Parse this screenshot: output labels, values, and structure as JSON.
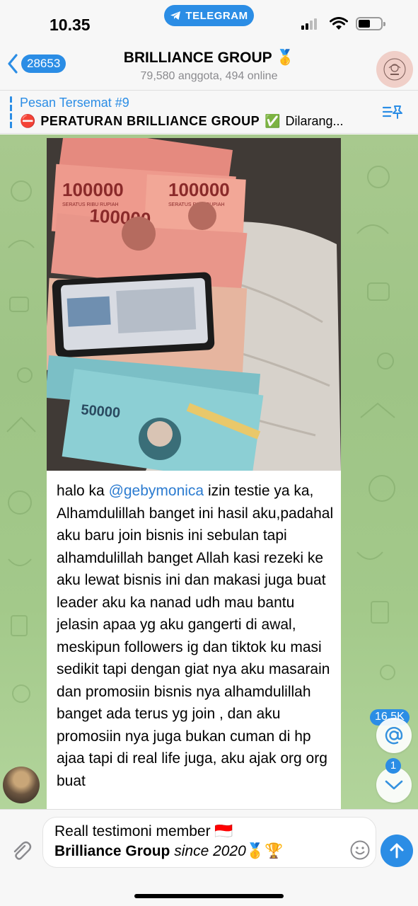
{
  "status_bar": {
    "time": "10.35",
    "app_pill": "TELEGRAM"
  },
  "header": {
    "back_count": "28653",
    "title": "BRILLIANCE GROUP",
    "title_emoji": "🥇",
    "subtitle": "79,580 anggota, 494 online"
  },
  "pinned": {
    "title": "Pesan Tersemat #9",
    "prefix_emoji": "⛔",
    "text_bold": "PERATURAN BRILLIANCE GROUP",
    "check_emoji": "✅",
    "text_rest": "Dilarang..."
  },
  "message": {
    "photo": {
      "banknote_100k": "100000",
      "banknote_100k_small": "SERATUS RIBU RUPIAH",
      "banknote_50k": "50000"
    },
    "greeting": "halo ka",
    "mention": "@gebymonica",
    "body": "izin testie ya ka, Alhamdulillah banget ini hasil aku,padahal aku baru join bisnis ini sebulan tapi alhamdulillah banget Allah kasi rezeki ke aku lewat bisnis ini dan makasi juga buat leader aku ka nanad udh mau bantu jelasin apaa yg aku gangerti di awal, meskipun followers ig dan tiktok ku masi sedikit tapi dengan giat nya aku masarain dan promosiin bisnis nya alhamdulillah banget ada terus yg join , dan aku promosiin nya juga bukan cuman di hp ajaa tapi di real life juga, aku ajak org org buat"
  },
  "floating": {
    "mention_count": "16.5K",
    "scroll_badge": "1"
  },
  "input": {
    "line1": "Reall testimoni member",
    "line1_emoji": "🇮🇩",
    "line2_bold": "Brilliance Group",
    "line2_italic": "since 2020",
    "line2_emoji": "🥇🏆"
  },
  "colors": {
    "accent": "#2b8de5",
    "chat_bg": "#a3c98a",
    "mention": "#2b7bd0"
  }
}
